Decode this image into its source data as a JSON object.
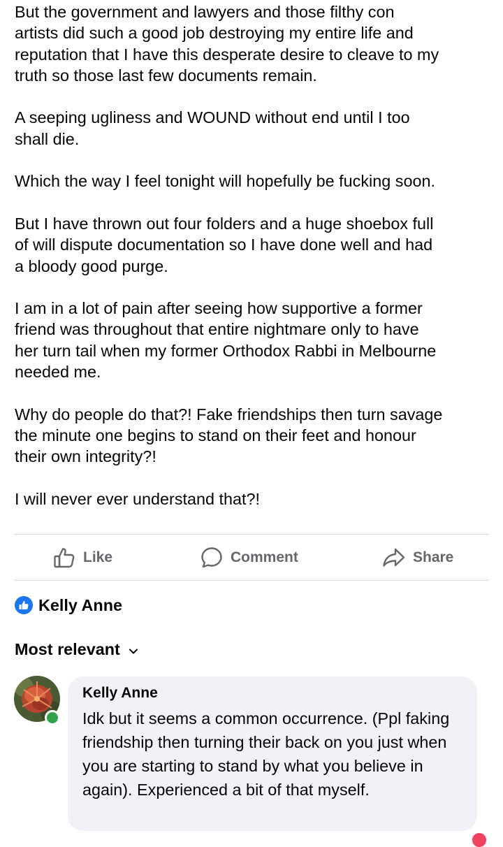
{
  "post": {
    "paragraphs": [
      "But the government and lawyers and those filthy con\nartists did such a good job destroying my entire life and\nreputation that I have this desperate desire to cleave to my\ntruth so those last few documents remain.",
      "A seeping ugliness and WOUND without end until I too\nshall die.",
      "Which the way I feel tonight will hopefully be fucking soon.",
      "But I have thrown out four folders and a huge shoebox full\nof will dispute documentation so I have done well and had\na bloody good purge.",
      "I am in a lot of pain after seeing how supportive a former\nfriend was throughout that entire nightmare only to have\nher turn tail when my former Orthodox Rabbi in Melbourne\nneeded me.",
      "Why do people do that?! Fake friendships then turn savage\nthe minute one begins to stand on their feet and honour\ntheir own integrity?!",
      "I will never ever understand that?!"
    ]
  },
  "actions": {
    "like": "Like",
    "comment": "Comment",
    "share": "Share"
  },
  "reactions": {
    "name": "Kelly Anne"
  },
  "comments_section": {
    "sort_label": "Most relevant"
  },
  "comment": {
    "author": "Kelly Anne",
    "text": "Idk but it seems a common occurrence. (Ppl faking friendship then turning their back on you just when you are starting to stand by what you believe in again). Experienced a bit of that myself."
  },
  "icons": {
    "like": "thumbs-up-outline-icon",
    "comment": "speech-bubble-icon",
    "share": "share-arrow-icon",
    "reaction": "like-reaction-icon",
    "sort": "chevron-down-icon"
  },
  "colors": {
    "text": "#050505",
    "secondary_text": "#65676b",
    "brand_blue": "#1877f2",
    "bubble_bg": "#f0f2f5",
    "online_green": "#31a24c",
    "divider": "#dadde1"
  }
}
